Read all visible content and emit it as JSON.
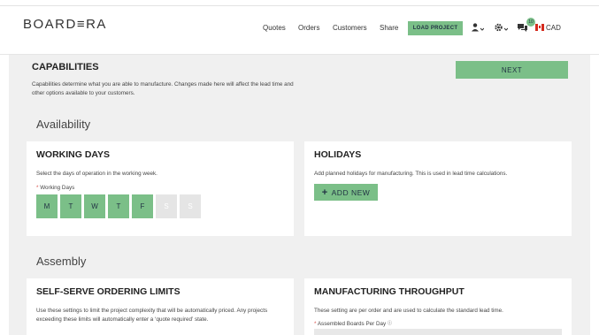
{
  "header": {
    "logo": "BOARD≡RA",
    "nav": [
      "Quotes",
      "Orders",
      "Customers",
      "Share"
    ],
    "load_project": "LOAD PROJECT",
    "notification_count": "10",
    "currency": "CAD"
  },
  "page": {
    "title": "CAPABILITIES",
    "description": "Capabilities determine what you are able to manufacture. Changes made here will affect the lead time and other options available to your customers.",
    "next_label": "NEXT"
  },
  "availability": {
    "section_title": "Availability",
    "working_days": {
      "title": "WORKING DAYS",
      "description": "Select the days of operation in the working week.",
      "field_label": "Working Days",
      "days": [
        {
          "label": "M",
          "active": true
        },
        {
          "label": "T",
          "active": true
        },
        {
          "label": "W",
          "active": true
        },
        {
          "label": "T",
          "active": true
        },
        {
          "label": "F",
          "active": true
        },
        {
          "label": "S",
          "active": false
        },
        {
          "label": "S",
          "active": false
        }
      ]
    },
    "holidays": {
      "title": "HOLIDAYS",
      "description": "Add planned holidays for manufacturing. This is used in lead time calculations.",
      "add_label": "ADD NEW"
    }
  },
  "assembly": {
    "section_title": "Assembly",
    "limits": {
      "title": "SELF-SERVE ORDERING LIMITS",
      "description": "Use these settings to limit the project complexity that will be automatically priced. Any projects exceeding these limits will automatically enter a ‘quote required’ state."
    },
    "throughput": {
      "title": "MANUFACTURING THROUGHPUT",
      "description": "These setting are per order and are used to calculate the standard lead time.",
      "field_label": "Assembled Boards Per Day"
    }
  },
  "colors": {
    "accent": "#7bbf88",
    "background": "#f0f0f0"
  }
}
